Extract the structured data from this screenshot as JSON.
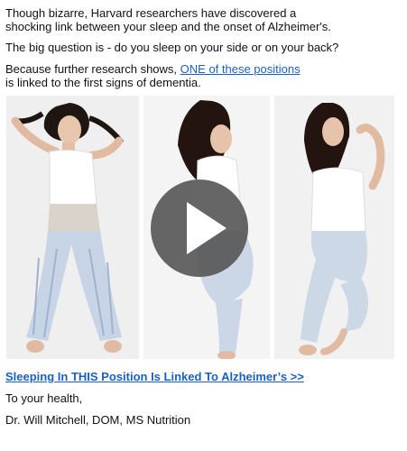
{
  "email": {
    "intro_line1": "Though bizarre, Harvard researchers have discovered a",
    "intro_line2": "shocking link between your sleep and the onset of Alzheimer's.",
    "question": "The big question is - do you sleep on your side or on your back?",
    "research_prefix": "Because further research shows, ",
    "research_link": "ONE of these positions",
    "research_suffix": "is linked to the first signs of dementia.",
    "cta_link": "Sleeping In THIS Position Is Linked To Alzheimer’s >>",
    "closing": "To your health,",
    "signature": "Dr. Will Mitchell, DOM, MS Nutrition"
  },
  "video": {
    "play_icon": "play-icon",
    "panels": [
      "back-sleeping-woman",
      "side-sleeping-woman",
      "leg-bent-sleeping-woman"
    ]
  },
  "colors": {
    "link": "#1a5fc9",
    "play_overlay": "#555555"
  }
}
